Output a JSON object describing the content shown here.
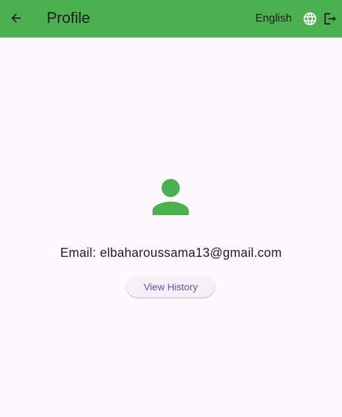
{
  "app_bar": {
    "title": "Profile",
    "back_icon": "arrow-back-icon",
    "language_label": "English",
    "language_icon": "globe-icon",
    "logout_icon": "logout-icon",
    "background_color": "#4caf50"
  },
  "profile": {
    "avatar_icon": "person-icon",
    "avatar_color": "#4caf50",
    "email_text": "Email: elbaharoussama13@gmail.com",
    "view_history_label": "View History"
  },
  "colors": {
    "background": "#fdf7fe",
    "button_text": "#6750a4",
    "button_background": "#f6eff8"
  }
}
